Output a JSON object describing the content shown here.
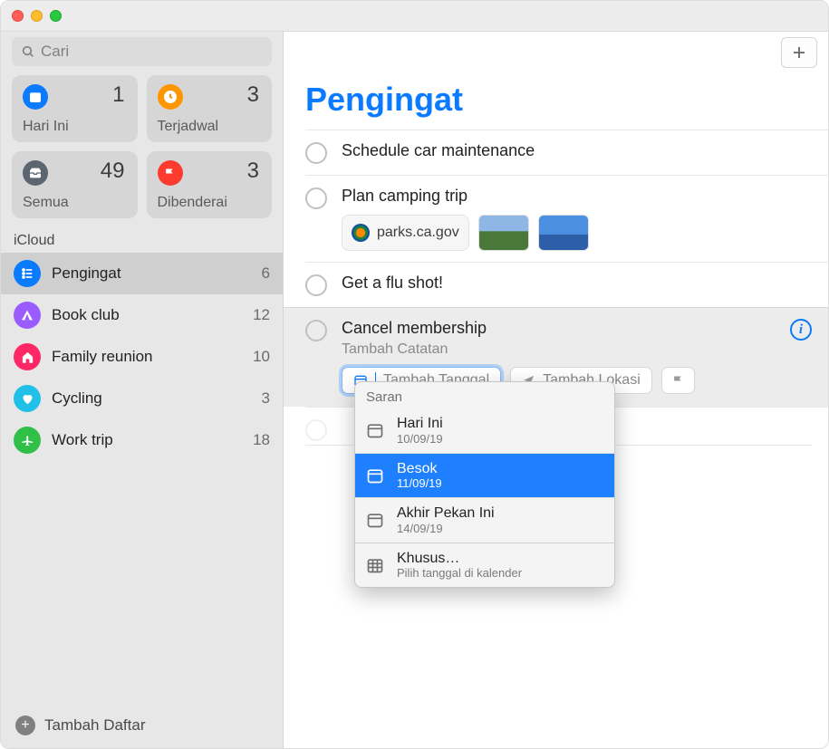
{
  "search": {
    "placeholder": "Cari"
  },
  "smart": [
    {
      "label": "Hari Ini",
      "count": "1",
      "color": "#0a7bff",
      "icon": "calendar"
    },
    {
      "label": "Terjadwal",
      "count": "3",
      "color": "#ff9500",
      "icon": "clock"
    },
    {
      "label": "Semua",
      "count": "49",
      "color": "#5b6670",
      "icon": "tray"
    },
    {
      "label": "Dibenderai",
      "count": "3",
      "color": "#ff3b30",
      "icon": "flag"
    }
  ],
  "section": "iCloud",
  "lists": [
    {
      "name": "Pengingat",
      "count": "6",
      "color": "#0a7bff",
      "icon": "list",
      "selected": true
    },
    {
      "name": "Book club",
      "count": "12",
      "color": "#9a5cff",
      "icon": "tent",
      "selected": false
    },
    {
      "name": "Family reunion",
      "count": "10",
      "color": "#ff2765",
      "icon": "home",
      "selected": false
    },
    {
      "name": "Cycling",
      "count": "3",
      "color": "#20c0e8",
      "icon": "heart",
      "selected": false
    },
    {
      "name": "Work trip",
      "count": "18",
      "color": "#30c048",
      "icon": "plane",
      "selected": false
    }
  ],
  "addList": "Tambah Daftar",
  "main": {
    "title": "Pengingat",
    "reminders": [
      {
        "title": "Schedule car maintenance"
      },
      {
        "title": "Plan camping trip",
        "url": "parks.ca.gov",
        "thumbs": 2
      },
      {
        "title": "Get a flu shot!"
      }
    ],
    "editing": {
      "title": "Cancel membership",
      "notePlaceholder": "Tambah Catatan",
      "datePlaceholder": "Tambah Tanggal",
      "locationPlaceholder": "Tambah Lokasi"
    }
  },
  "popover": {
    "header": "Saran",
    "options": [
      {
        "title": "Hari Ini",
        "sub": "10/09/19",
        "selected": false
      },
      {
        "title": "Besok",
        "sub": "11/09/19",
        "selected": true
      },
      {
        "title": "Akhir Pekan Ini",
        "sub": "14/09/19",
        "selected": false
      }
    ],
    "custom": {
      "title": "Khusus…",
      "sub": "Pilih tanggal di kalender"
    }
  }
}
